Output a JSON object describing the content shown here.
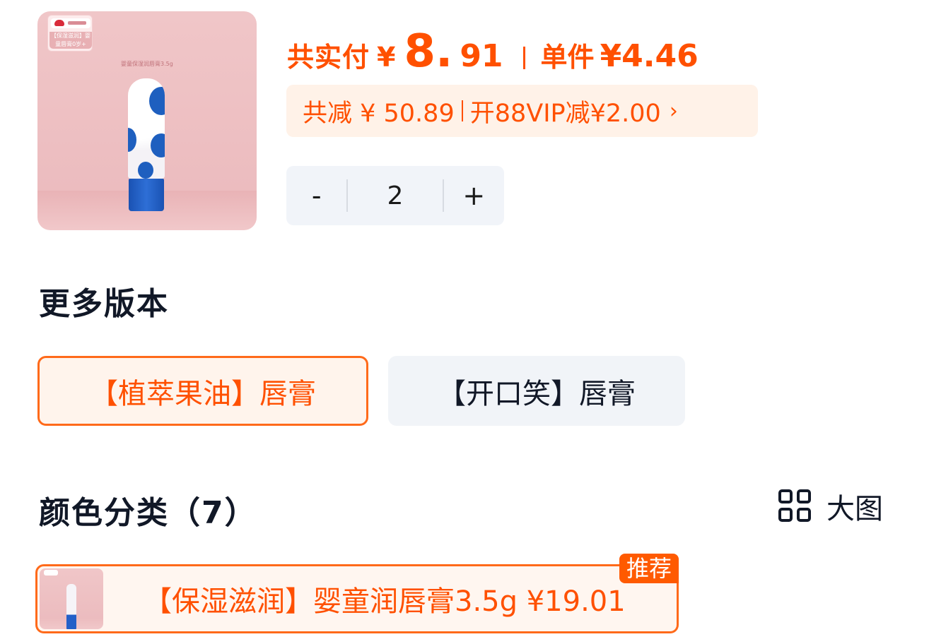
{
  "product": {
    "image_badge": "【保湿滋润】婴童唇膏0岁+",
    "image_caption": "婴童保湿润唇膏3.5g"
  },
  "price": {
    "label": "共实付",
    "currency": "¥",
    "integer": "8.",
    "decimal": "91",
    "unit_label": "单件",
    "unit_price": "¥4.46"
  },
  "discount": {
    "total_off": "共减 ¥ 50.89",
    "vip_offer": "开88VIP减¥2.00",
    "chevron": "›"
  },
  "quantity": {
    "minus": "-",
    "value": "2",
    "plus": "+"
  },
  "versions": {
    "title": "更多版本",
    "options": [
      {
        "label": "【植萃果油】唇膏",
        "selected": true
      },
      {
        "label": "【开口笑】唇膏",
        "selected": false
      }
    ]
  },
  "colors": {
    "title": "颜色分类（7）",
    "big_view_label": "大图",
    "big_view_icon": "grid-icon",
    "options": [
      {
        "label": "【保湿滋润】婴童润唇膏3.5g  ¥19.01",
        "tag": "推荐",
        "selected": true
      }
    ]
  },
  "accent_color": "#ff5000"
}
